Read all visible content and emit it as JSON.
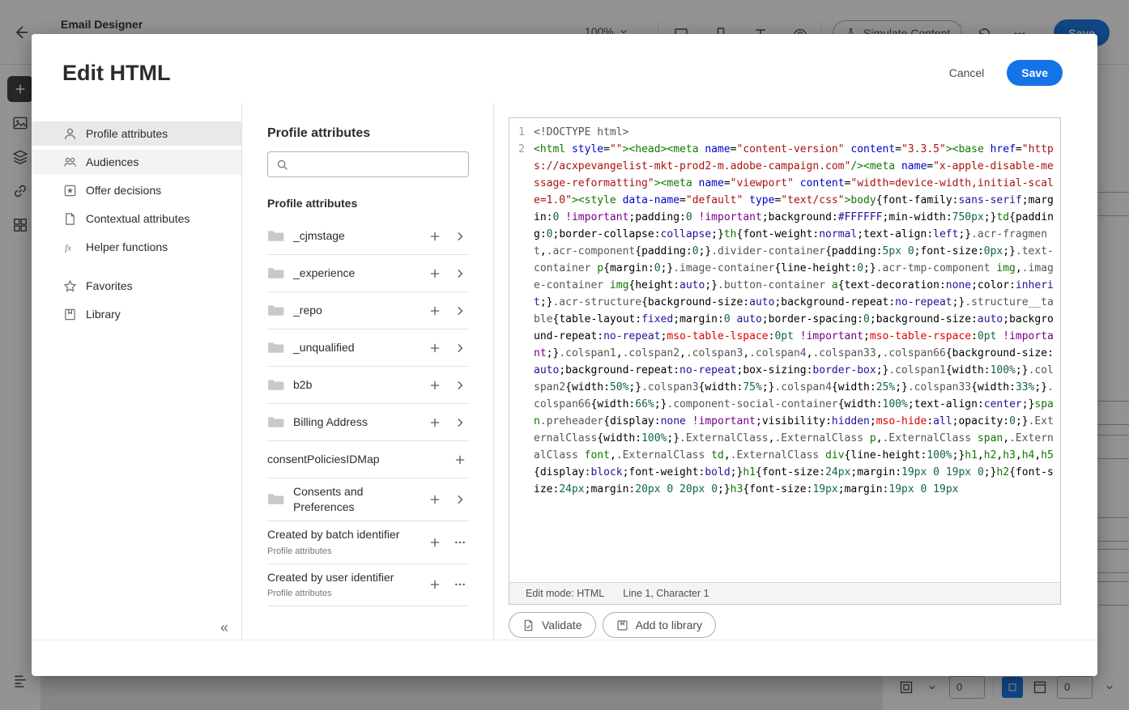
{
  "background": {
    "topbar": {
      "title": "Email Designer",
      "zoom_value": "100%",
      "simulate_button": "Simulate Content",
      "save_button": "Save"
    },
    "bottombar": {
      "field1_value": "0",
      "field2_value": "0"
    }
  },
  "modal": {
    "title": "Edit HTML",
    "cancel_button": "Cancel",
    "save_button": "Save",
    "nav": {
      "items": [
        {
          "label": "Profile attributes",
          "icon": "user-icon",
          "state": "selected"
        },
        {
          "label": "Audiences",
          "icon": "audiences-icon",
          "state": "hover"
        },
        {
          "label": "Offer decisions",
          "icon": "offer-decisions-icon",
          "state": ""
        },
        {
          "label": "Contextual attributes",
          "icon": "contextual-attributes-icon",
          "state": ""
        },
        {
          "label": "Helper functions",
          "icon": "helper-functions-icon",
          "state": ""
        }
      ],
      "secondary_items": [
        {
          "label": "Favorites",
          "icon": "star-icon",
          "state": ""
        },
        {
          "label": "Library",
          "icon": "library-icon",
          "state": ""
        }
      ],
      "collapse_glyph": "«"
    },
    "attributes": {
      "title": "Profile attributes",
      "search_placeholder": "",
      "list_title": "Profile attributes",
      "rows": [
        {
          "label": "_cjmstage",
          "icon": "folder-icon",
          "actions": [
            "add",
            "open"
          ]
        },
        {
          "label": "_experience",
          "icon": "folder-icon",
          "actions": [
            "add",
            "open"
          ]
        },
        {
          "label": "_repo",
          "icon": "folder-icon",
          "actions": [
            "add",
            "open"
          ]
        },
        {
          "label": "_unqualified",
          "icon": "folder-icon",
          "actions": [
            "add",
            "open"
          ]
        },
        {
          "label": "b2b",
          "icon": "folder-icon",
          "actions": [
            "add",
            "open"
          ]
        },
        {
          "label": "Billing Address",
          "icon": "folder-icon",
          "actions": [
            "add",
            "open"
          ]
        },
        {
          "label": "consentPoliciesIDMap",
          "icon": null,
          "actions": [
            "add"
          ]
        },
        {
          "label": "Consents and Preferences",
          "icon": "folder-icon",
          "actions": [
            "add",
            "open"
          ]
        },
        {
          "label": "Created by batch identifier",
          "sublabel": "Profile attributes",
          "icon": null,
          "actions": [
            "add",
            "more"
          ]
        },
        {
          "label": "Created by user identifier",
          "sublabel": "Profile attributes",
          "icon": null,
          "actions": [
            "add",
            "more"
          ]
        }
      ]
    },
    "editor": {
      "lines": [
        "<!DOCTYPE html>",
        "<html style=\"\"><head><meta name=\"content-version\" content=\"3.3.5\"><base href=\"https://acxpevangelist-mkt-prod2-m.adobe-campaign.com\"/><meta name=\"x-apple-disable-message-reformatting\"><meta name=\"viewport\" content=\"width=device-width,initial-scale=1.0\"><style data-name=\"default\" type=\"text/css\">body{font-family:sans-serif;margin:0 !important;padding:0 !important;background:#FFFFFF;min-width:750px;}td{padding:0;border-collapse:collapse;}th{font-weight:normal;text-align:left;}.acr-fragment,.acr-component{padding:0;}.divider-container{padding:5px 0;font-size:0px;}.text-container p{margin:0;}.image-container{line-height:0;}.acr-tmp-component img,.image-container img{height:auto;}.button-container a{text-decoration:none;color:inherit;}.acr-structure{background-size:auto;background-repeat:no-repeat;}.structure__table{table-layout:fixed;margin:0 auto;border-spacing:0;background-size:auto;background-repeat:no-repeat;mso-table-lspace:0pt !important;mso-table-rspace:0pt !important;}.colspan1,.colspan2,.colspan3,.colspan4,.colspan33,.colspan66{background-size:auto;background-repeat:no-repeat;box-sizing:border-box;}.colspan1{width:100%;}.colspan2{width:50%;}.colspan3{width:75%;}.colspan4{width:25%;}.colspan33{width:33%;}.colspan66{width:66%;}.component-social-container{width:100%;text-align:center;}span.preheader{display:none !important;visibility:hidden;mso-hide:all;opacity:0;}.ExternalClass{width:100%;}.ExternalClass,.ExternalClass p,.ExternalClass span,.ExternalClass font,.ExternalClass td,.ExternalClass div{line-height:100%;}h1,h2,h3,h4,h5{display:block;font-weight:bold;}h1{font-size:24px;margin:19px 0 19px 0;}h2{font-size:24px;margin:20px 0 20px 0;}h3{font-size:19px;margin:19px 0 19px"
      ],
      "status_mode": "Edit mode: HTML",
      "status_position": "Line 1, Character 1",
      "validate_button": "Validate",
      "add_to_library_button": "Add to library",
      "syntax_colors": {
        "tag": "#117700",
        "attribute": "#0000cc",
        "string": "#aa1111",
        "number": "#116644",
        "atom": "#221199",
        "qualifier": "#555555",
        "property": "#000000",
        "keyword": "#770088",
        "error": "#e00000",
        "meta": "#555555",
        "plain": "#000000"
      }
    }
  }
}
